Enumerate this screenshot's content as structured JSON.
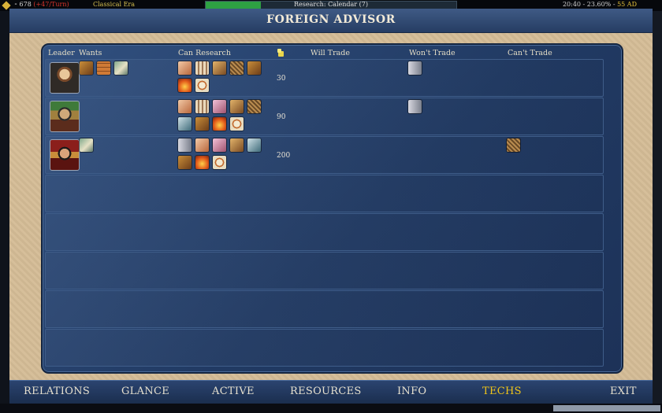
{
  "hud": {
    "gold": "⁃ 678",
    "gold_delta": "(+47/Turn)",
    "era": "Classical Era",
    "research": "Research: Calendar (7)",
    "research_progress": 0.22,
    "clock": "20:40 - 23.60% - ",
    "year": "55 AD"
  },
  "window": {
    "title": "FOREIGN ADVISOR"
  },
  "columns": {
    "leader": "Leader",
    "wants": "Wants",
    "can_research": "Can Research",
    "gold_icon": "gold-coin-icon",
    "will_trade": "Will Trade",
    "wont_trade": "Won't Trade",
    "cant_trade": "Can't Trade"
  },
  "rows": [
    {
      "leader": "leader-portrait-1",
      "wants": [
        "hammer-tech-icon",
        "brick-tech-icon",
        "chariot-tech-icon"
      ],
      "can_research": [
        "scroll-tech-icon",
        "columns-tech-icon",
        "horse-tech-icon",
        "weave-tech-icon",
        "hammer-tech-icon",
        "sun-tech-icon",
        "compass-tech-icon"
      ],
      "gold": "30",
      "will_trade": [],
      "wont_trade": [
        "fork-tech-icon"
      ],
      "cant_trade": []
    },
    {
      "leader": "leader-portrait-2",
      "wants": [],
      "can_research": [
        "scroll-tech-icon",
        "columns-tech-icon",
        "pink-tech-icon",
        "horse-tech-icon",
        "weave-tech-icon",
        "ship-tech-icon",
        "hammer-tech-icon",
        "sun-tech-icon",
        "compass-tech-icon"
      ],
      "gold": "90",
      "will_trade": [],
      "wont_trade": [
        "fork-tech-icon"
      ],
      "cant_trade": []
    },
    {
      "leader": "leader-portrait-3",
      "wants": [
        "chariot-tech-icon"
      ],
      "can_research": [
        "fork-tech-icon",
        "scroll-tech-icon",
        "pink-tech-icon",
        "horse-tech-icon",
        "ship-tech-icon",
        "hammer-tech-icon",
        "sun-tech-icon",
        "compass-tech-icon"
      ],
      "gold": "200",
      "will_trade": [],
      "wont_trade": [],
      "cant_trade": [
        "weave-tech-icon"
      ]
    }
  ],
  "nav": {
    "relations": "RELATIONS",
    "glance": "GLANCE",
    "active": "ACTIVE",
    "resources": "RESOURCES",
    "info": "INFO",
    "techs": "TECHS",
    "exit": "EXIT"
  }
}
